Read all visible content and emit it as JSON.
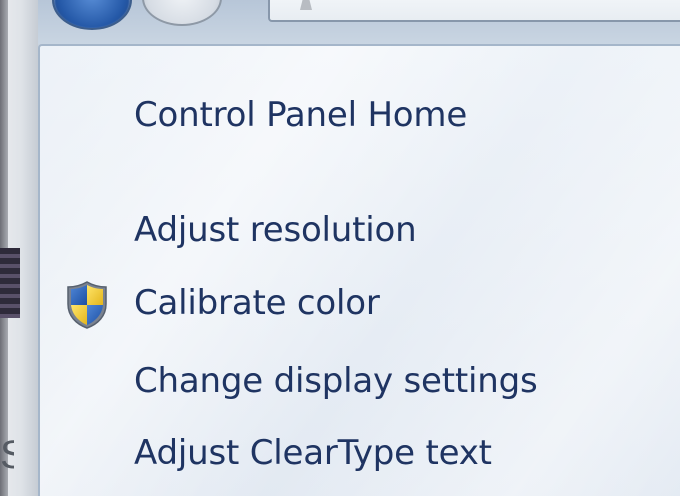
{
  "window": {
    "left_edge_glyph": "S"
  },
  "nav_pane": {
    "home_link": "Control Panel Home",
    "tasks": [
      {
        "label": "Adjust resolution",
        "icon": null
      },
      {
        "label": "Calibrate color",
        "icon": "uac-shield-icon"
      },
      {
        "label": "Change display settings",
        "icon": null
      },
      {
        "label": "Adjust ClearType text",
        "icon": null
      }
    ]
  },
  "colors": {
    "link": "#1f3462",
    "pane_bg": "#e6edf5",
    "back_button": "#2559a8"
  }
}
